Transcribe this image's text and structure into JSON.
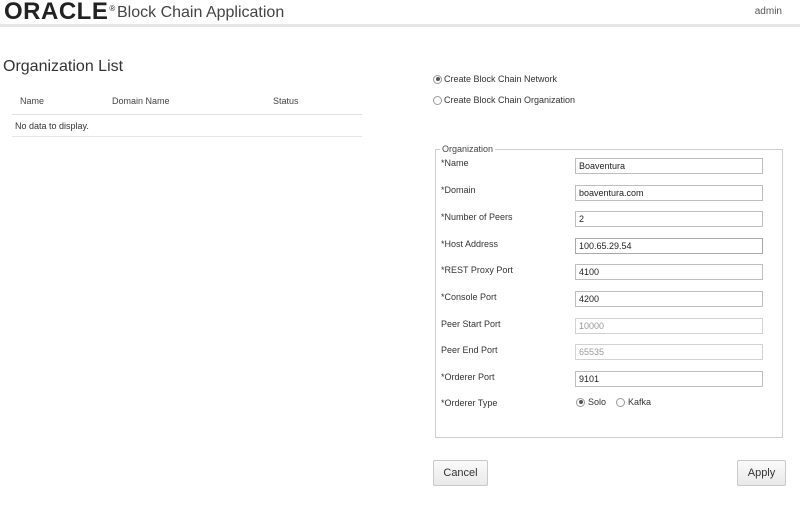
{
  "header": {
    "logo_text": "ORACLE",
    "logo_mark": "®",
    "app_title": "Block Chain Application",
    "user": "admin"
  },
  "org_list": {
    "title": "Organization List",
    "columns": [
      "Name",
      "Domain Name",
      "Status"
    ],
    "empty_message": "No data to display."
  },
  "mode_options": [
    {
      "label": "Create Block Chain Network",
      "selected": true
    },
    {
      "label": "Create Block Chain Organization",
      "selected": false
    }
  ],
  "form": {
    "legend": "Organization",
    "fields": [
      {
        "label": "*Name",
        "value": "Boaventura"
      },
      {
        "label": "*Domain",
        "value": "boaventura.com"
      },
      {
        "label": "*Number of Peers",
        "value": "2"
      },
      {
        "label": "*Host Address",
        "value": "100.65.29.54"
      },
      {
        "label": "*REST Proxy Port",
        "value": "4100"
      },
      {
        "label": "*Console Port",
        "value": "4200"
      },
      {
        "label": "Peer Start Port",
        "value": "10000"
      },
      {
        "label": "Peer End Port",
        "value": "65535"
      },
      {
        "label": "*Orderer Port",
        "value": "9101"
      }
    ],
    "orderer_type": {
      "label": "*Orderer Type",
      "options": [
        {
          "label": "Solo",
          "selected": true
        },
        {
          "label": "Kafka",
          "selected": false
        }
      ]
    }
  },
  "buttons": {
    "cancel": "Cancel",
    "apply": "Apply"
  }
}
